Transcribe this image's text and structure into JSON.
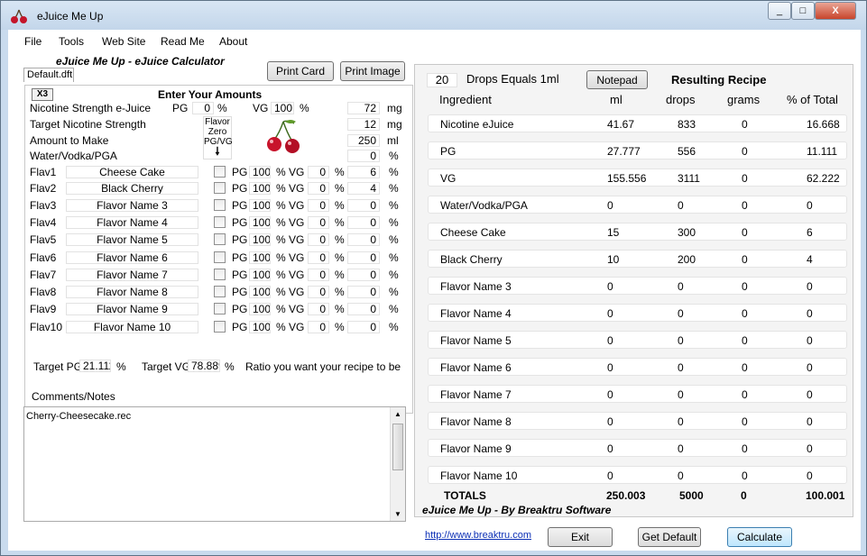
{
  "window": {
    "title": "eJuice Me Up",
    "controls": [
      "_",
      "□",
      "X"
    ]
  },
  "menu": [
    "File",
    "Tools",
    "Web Site",
    "Read Me",
    "About"
  ],
  "calc_title": "eJuice Me Up - eJuice Calculator",
  "file_tab": "Default.dft",
  "buttons": {
    "print_card": "Print Card",
    "print_image": "Print Image",
    "notepad": "Notepad",
    "exit": "Exit",
    "get_default": "Get Default",
    "calculate": "Calculate"
  },
  "x3": "X3",
  "enter_amounts": "Enter Your Amounts",
  "nicotine": {
    "label": "Nicotine Strength e-Juice",
    "pg_label": "PG",
    "pg": "0",
    "vg_label": "VG",
    "vg": "100",
    "pct": "%",
    "value": "72",
    "unit": "mg"
  },
  "target_nic": {
    "label": "Target Nicotine Strength",
    "value": "12",
    "unit": "mg"
  },
  "amount": {
    "label": "Amount to Make",
    "value": "250",
    "unit": "ml"
  },
  "water": {
    "label": "Water/Vodka/PGA",
    "value": "0",
    "unit": "%"
  },
  "flavor_zero": {
    "line1": "Flavor",
    "line2": "Zero",
    "line3": "PG/VG",
    "arrow": "🠗"
  },
  "flavors": [
    {
      "label": "Flav1",
      "name": "Cheese Cake",
      "pg": "100",
      "vg": "0",
      "pct": "6"
    },
    {
      "label": "Flav2",
      "name": "Black Cherry",
      "pg": "100",
      "vg": "0",
      "pct": "4"
    },
    {
      "label": "Flav3",
      "name": "Flavor Name 3",
      "pg": "100",
      "vg": "0",
      "pct": "0"
    },
    {
      "label": "Flav4",
      "name": "Flavor Name 4",
      "pg": "100",
      "vg": "0",
      "pct": "0"
    },
    {
      "label": "Flav5",
      "name": "Flavor Name 5",
      "pg": "100",
      "vg": "0",
      "pct": "0"
    },
    {
      "label": "Flav6",
      "name": "Flavor Name 6",
      "pg": "100",
      "vg": "0",
      "pct": "0"
    },
    {
      "label": "Flav7",
      "name": "Flavor Name 7",
      "pg": "100",
      "vg": "0",
      "pct": "0"
    },
    {
      "label": "Flav8",
      "name": "Flavor Name 8",
      "pg": "100",
      "vg": "0",
      "pct": "0"
    },
    {
      "label": "Flav9",
      "name": "Flavor Name 9",
      "pg": "100",
      "vg": "0",
      "pct": "0"
    },
    {
      "label": "Flav10",
      "name": "Flavor Name 10",
      "pg": "100",
      "vg": "0",
      "pct": "0"
    }
  ],
  "flav_labels": {
    "pg": "PG",
    "vg": "VG",
    "pct": "%"
  },
  "target": {
    "pg_label": "Target PG",
    "pg": "21.111",
    "vg_label": "Target VG",
    "vg": "78.889",
    "pct": "%",
    "ratio_text": "Ratio you want your recipe to be"
  },
  "comments": {
    "label": "Comments/Notes",
    "text": "Cherry-Cheesecake.rec"
  },
  "drops": {
    "value": "20",
    "label": "Drops Equals 1ml"
  },
  "recipe_title": "Resulting Recipe",
  "columns": [
    "Ingredient",
    "ml",
    "drops",
    "grams",
    "% of Total"
  ],
  "rows": [
    [
      "Nicotine eJuice",
      "41.67",
      "833",
      "0",
      "16.668"
    ],
    [
      "PG",
      "27.777",
      "556",
      "0",
      "11.111"
    ],
    [
      "VG",
      "155.556",
      "3111",
      "0",
      "62.222"
    ],
    [
      "Water/Vodka/PGA",
      "0",
      "0",
      "0",
      "0"
    ],
    [
      "Cheese Cake",
      "15",
      "300",
      "0",
      "6"
    ],
    [
      "Black Cherry",
      "10",
      "200",
      "0",
      "4"
    ],
    [
      "Flavor Name 3",
      "0",
      "0",
      "0",
      "0"
    ],
    [
      "Flavor Name 4",
      "0",
      "0",
      "0",
      "0"
    ],
    [
      "Flavor Name 5",
      "0",
      "0",
      "0",
      "0"
    ],
    [
      "Flavor Name 6",
      "0",
      "0",
      "0",
      "0"
    ],
    [
      "Flavor Name 7",
      "0",
      "0",
      "0",
      "0"
    ],
    [
      "Flavor Name 8",
      "0",
      "0",
      "0",
      "0"
    ],
    [
      "Flavor Name 9",
      "0",
      "0",
      "0",
      "0"
    ],
    [
      "Flavor Name 10",
      "0",
      "0",
      "0",
      "0"
    ]
  ],
  "totals": [
    "TOTALS",
    "250.003",
    "5000",
    "0",
    "100.001"
  ],
  "footer": {
    "credit": "eJuice Me Up -  By Breaktru Software",
    "link": "http://www.breaktru.com"
  }
}
